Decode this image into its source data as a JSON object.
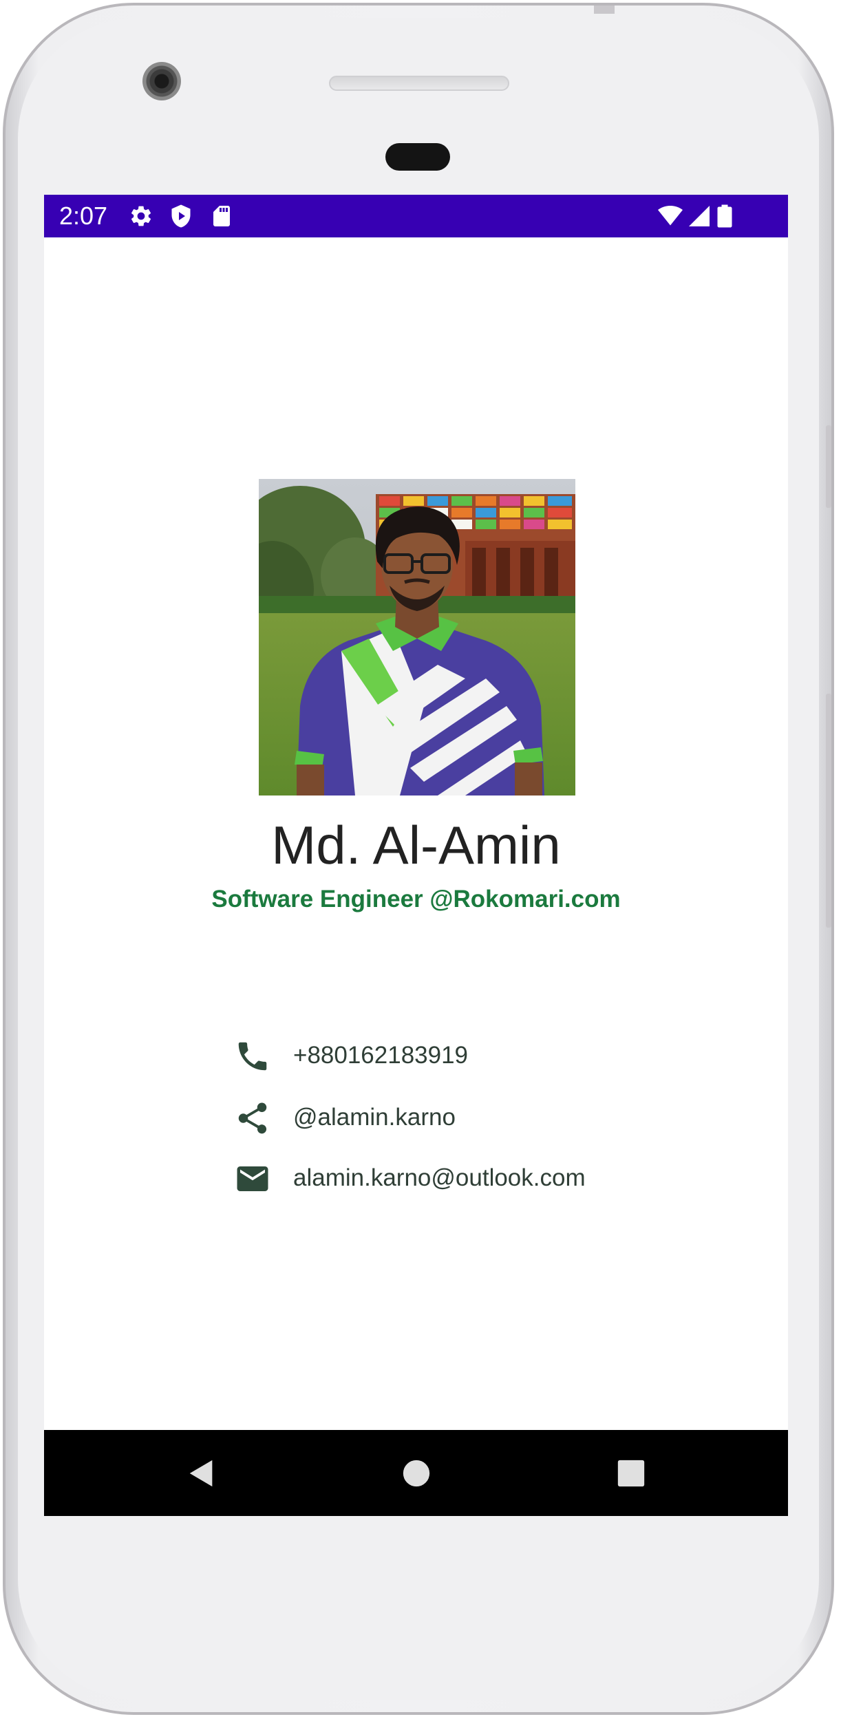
{
  "status_bar": {
    "time": "2:07",
    "left_icons": [
      "gear-icon",
      "shield-play-icon",
      "sd-card-icon"
    ],
    "right_icons": [
      "wifi-icon",
      "cell-signal-icon",
      "battery-icon"
    ],
    "background_color": "#3700b3"
  },
  "profile": {
    "photo_icon": "profile-photo",
    "name": "Md. Al-Amin",
    "title": "Software Engineer @Rokomari.com",
    "title_color": "#1b7a3e"
  },
  "contacts": [
    {
      "icon": "phone-icon",
      "text": "+880162183919"
    },
    {
      "icon": "share-icon",
      "text": "@alamin.karno"
    },
    {
      "icon": "email-icon",
      "text": "alamin.karno@outlook.com"
    }
  ],
  "nav_bar": {
    "buttons": [
      "back-icon",
      "home-icon",
      "recents-icon"
    ]
  }
}
